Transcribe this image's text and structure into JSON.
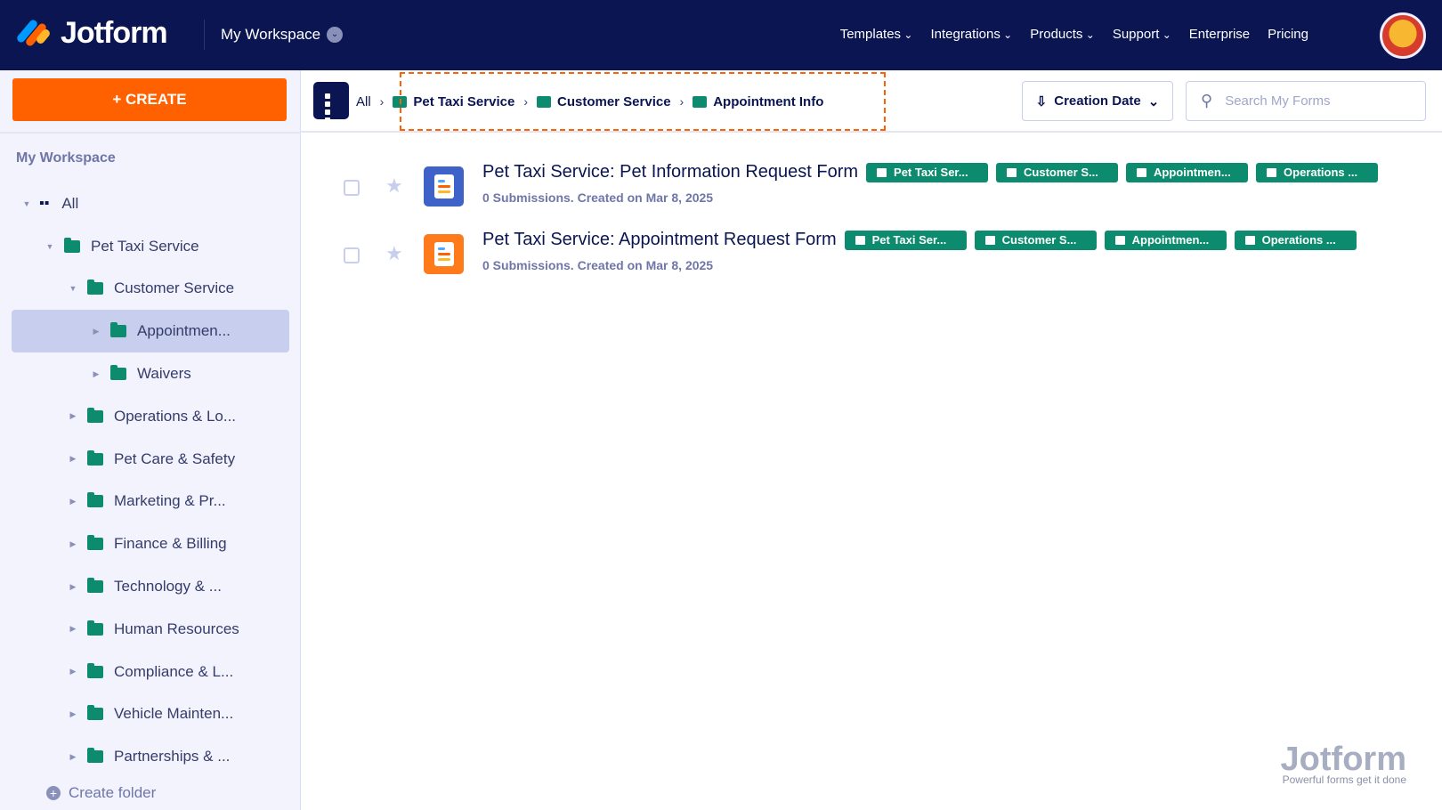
{
  "header": {
    "brand": "Jotform",
    "workspace": "My Workspace",
    "nav": [
      "Templates",
      "Integrations",
      "Products",
      "Support",
      "Enterprise",
      "Pricing"
    ]
  },
  "sidebar": {
    "create_label": "+ CREATE",
    "title": "My Workspace",
    "create_folder": "Create folder",
    "items": [
      {
        "label": "All",
        "depth": 0,
        "expanded": true,
        "kind": "all"
      },
      {
        "label": "Pet Taxi Service",
        "depth": 1,
        "expanded": true
      },
      {
        "label": "Customer Service",
        "depth": 2,
        "expanded": true
      },
      {
        "label": "Appointmen...",
        "depth": 3,
        "selected": true
      },
      {
        "label": "Waivers",
        "depth": 3
      },
      {
        "label": "Operations & Lo...",
        "depth": 2
      },
      {
        "label": "Pet Care & Safety",
        "depth": 2
      },
      {
        "label": "Marketing & Pr...",
        "depth": 2
      },
      {
        "label": "Finance & Billing",
        "depth": 2
      },
      {
        "label": "Technology & ...",
        "depth": 2
      },
      {
        "label": "Human Resources",
        "depth": 2
      },
      {
        "label": "Compliance & L...",
        "depth": 2
      },
      {
        "label": "Vehicle Mainten...",
        "depth": 2
      },
      {
        "label": "Partnerships & ...",
        "depth": 2
      }
    ]
  },
  "toolbar": {
    "all": "All",
    "breadcrumb": [
      "Pet Taxi Service",
      "Customer Service",
      "Appointment Info"
    ],
    "sort_label": "Creation Date",
    "search_placeholder": "Search My Forms"
  },
  "forms": [
    {
      "title": "Pet Taxi Service: Pet Information Request Form",
      "meta": "0 Submissions. Created on Mar 8, 2025",
      "color": "#3e62c8",
      "tags": [
        "Pet Taxi Ser...",
        "Customer S...",
        "Appointmen...",
        "Operations ..."
      ]
    },
    {
      "title": "Pet Taxi Service: Appointment Request Form",
      "meta": "0 Submissions. Created on Mar 8, 2025",
      "color": "#ff7a1a",
      "tags": [
        "Pet Taxi Ser...",
        "Customer S...",
        "Appointmen...",
        "Operations ..."
      ]
    }
  ],
  "watermark": {
    "brand": "Jotform",
    "tagline": "Powerful forms get it done"
  }
}
